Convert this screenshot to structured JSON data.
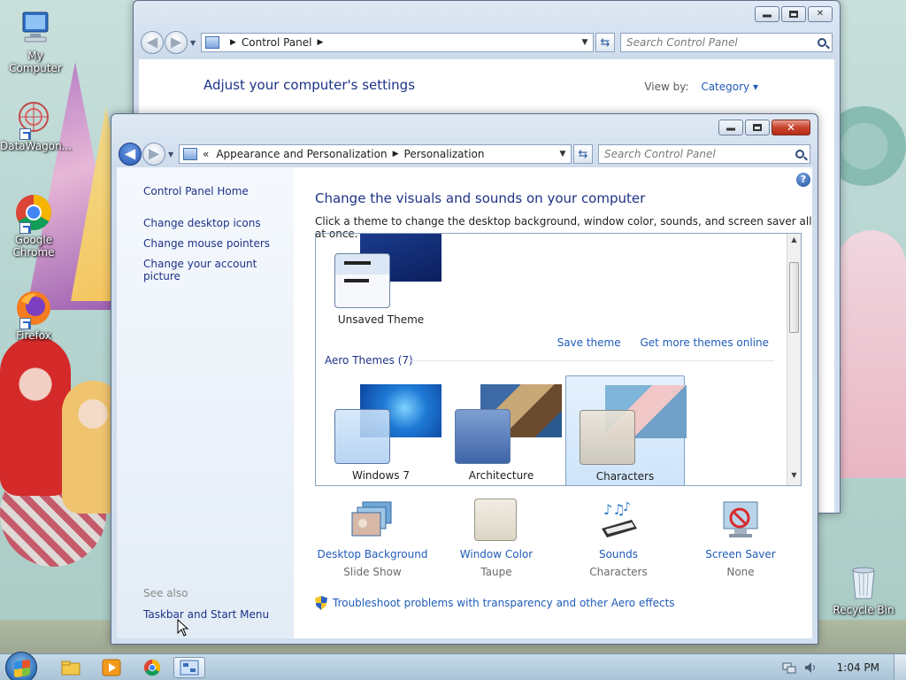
{
  "desktop": {
    "icons": [
      {
        "label": "My Computer",
        "icon": "computer-icon"
      },
      {
        "label": "DataWagon...",
        "icon": "datawagon-icon"
      },
      {
        "label": "Google Chrome",
        "icon": "chrome-icon"
      },
      {
        "label": "Firefox",
        "icon": "firefox-icon"
      },
      {
        "label": "Recycle Bin",
        "icon": "recycle-bin-icon"
      }
    ]
  },
  "back_window": {
    "breadcrumb": [
      "Control Panel"
    ],
    "search_placeholder": "Search Control Panel",
    "title": "Adjust your computer's settings",
    "view_by_label": "View by:",
    "view_by_value": "Category"
  },
  "front_window": {
    "breadcrumb_prefix": "«",
    "breadcrumb": [
      "Appearance and Personalization",
      "Personalization"
    ],
    "search_placeholder": "Search Control Panel",
    "sidebar": {
      "home": "Control Panel Home",
      "links": [
        "Change desktop icons",
        "Change mouse pointers",
        "Change your account picture"
      ],
      "see_also": "See also",
      "see_also_links": [
        "Taskbar and Start Menu"
      ]
    },
    "main": {
      "title": "Change the visuals and sounds on your computer",
      "subtitle": "Click a theme to change the desktop background, window color, sounds, and screen saver all at once.",
      "unsaved_theme": "Unsaved Theme",
      "save_theme": "Save theme",
      "get_more": "Get more themes online",
      "aero_heading": "Aero Themes (7)",
      "themes": [
        {
          "name": "Windows 7",
          "selected": false
        },
        {
          "name": "Architecture",
          "selected": false
        },
        {
          "name": "Characters",
          "selected": true
        }
      ],
      "settings": [
        {
          "label": "Desktop Background",
          "value": "Slide Show",
          "icon": "desktop-background-icon"
        },
        {
          "label": "Window Color",
          "value": "Taupe",
          "icon": "window-color-icon"
        },
        {
          "label": "Sounds",
          "value": "Characters",
          "icon": "sounds-icon"
        },
        {
          "label": "Screen Saver",
          "value": "None",
          "icon": "screen-saver-icon"
        }
      ],
      "troubleshoot": "Troubleshoot problems with transparency and other Aero effects"
    }
  },
  "taskbar": {
    "clock": "1:04 PM",
    "pinned": [
      "explorer-icon",
      "media-player-icon",
      "chrome-icon",
      "control-panel-icon"
    ]
  }
}
